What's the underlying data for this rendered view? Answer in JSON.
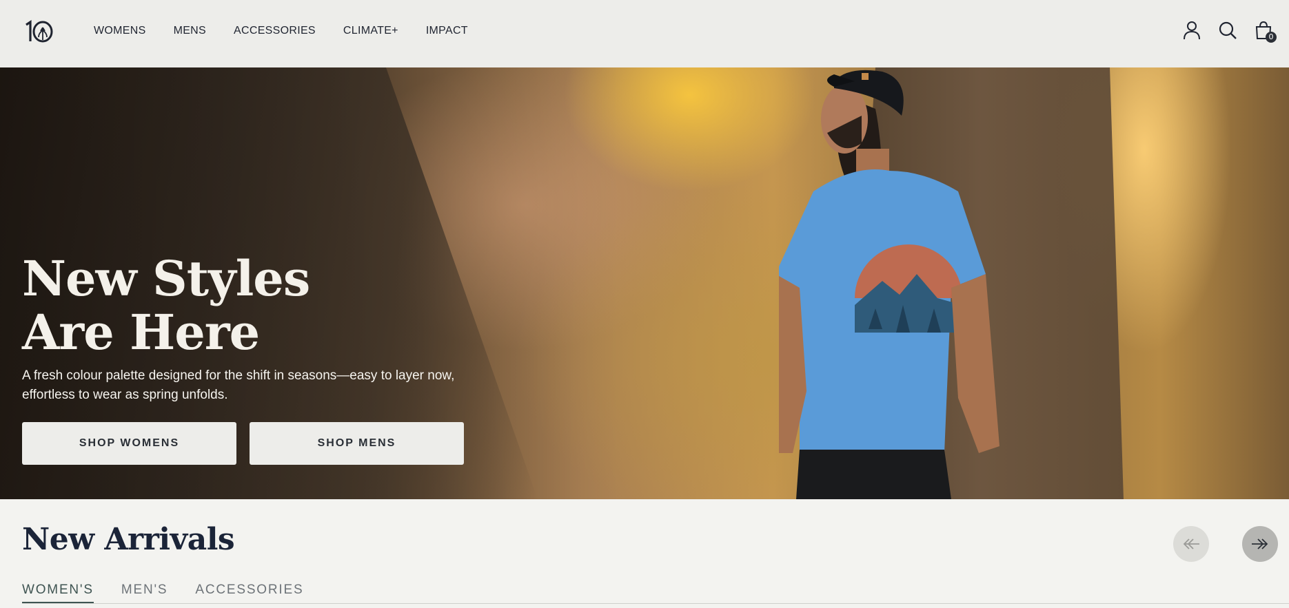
{
  "header": {
    "logo_alt": "10",
    "nav": [
      "WOMENS",
      "MENS",
      "ACCESSORIES",
      "CLIMATE+",
      "IMPACT"
    ],
    "icons": [
      "account-icon",
      "search-icon",
      "cart-icon"
    ],
    "cart_count": "0"
  },
  "hero": {
    "title": "New Styles Are Here",
    "subtitle": "A fresh colour palette designed for the shift in seasons—easy to layer now, effortless to wear as spring unfolds.",
    "buttons": {
      "women": "SHOP WOMENS",
      "men": "SHOP MENS"
    }
  },
  "arrivals": {
    "title": "New Arrivals",
    "tabs": [
      "WOMEN'S",
      "MEN'S",
      "ACCESSORIES"
    ],
    "active_tab": "WOMEN'S"
  },
  "colors": {
    "header_bg": "#ededea",
    "page_bg": "#f3f3f0",
    "accent": "#3f5452",
    "shirt": "#5a9bd8"
  }
}
